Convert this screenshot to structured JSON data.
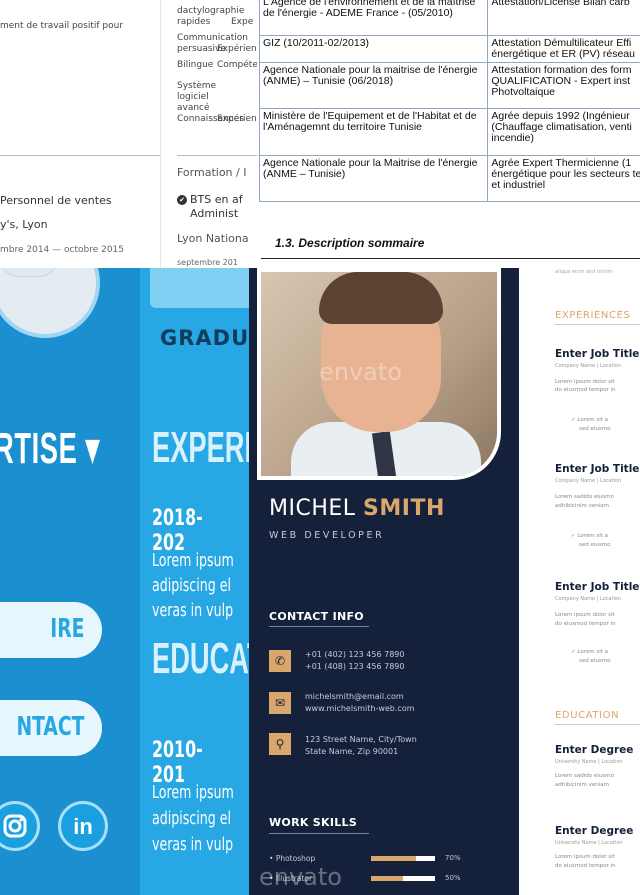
{
  "top_left": {
    "fragment": "ment de travail positif pour",
    "job_title": "Personnel de ventes",
    "employer": "y's, Lyon",
    "dates": "mbre 2014 — octobre 2015"
  },
  "top_middle": {
    "skill_rows": [
      {
        "left": "dactylographie",
        "right": ""
      },
      {
        "left": "rapides",
        "right": "Expe"
      },
      {
        "left": "Communication",
        "right": ""
      },
      {
        "left": "persuasive",
        "right": "Expérience"
      },
      {
        "left": "Bilingue",
        "right": "Compétent"
      },
      {
        "left": "Système",
        "right": ""
      },
      {
        "left": "logiciel",
        "right": ""
      },
      {
        "left": "avancé",
        "right": ""
      },
      {
        "left": "Connaissances",
        "right": "Expérience"
      }
    ],
    "formation_heading": "Formation / I",
    "education_line1": "BTS en af",
    "education_line2": "Administ",
    "location": "Lyon Nationa",
    "dates": "septembre 201"
  },
  "top_right": {
    "rows": [
      {
        "org": "L'Agence de l'environnement et de la maîtrise de l'énergie - ADEME France - (05/2010)",
        "cert": "Attestation/License  Bilan carb"
      },
      {
        "org": "GIZ (10/2011-02/2013)",
        "cert": "Attestation Démultilicateur Effi énergétique et ER (PV) réseau"
      },
      {
        "org": "Agence Nationale pour la maitrise de l'énergie                    (ANME) – Tunisie (06/2018)",
        "cert": "Attestation formation des form QUALIFICATION - Expert inst Photvoltaique"
      },
      {
        "org": "Ministère de l'Equipement et de l'Habitat et de l'Aménagemnt du territoire Tunisie",
        "cert": "Agrée depuis 1992 (Ingénieur (Chauffage climatisation, venti incendie)"
      },
      {
        "org": "Agence Nationale pour la Maitrise de l'énergie (ANME – Tunisie)",
        "cert": "Agrée Expert Thermicienne (1 énergétique pour les secteurs tertiaire et industriel"
      }
    ],
    "section_heading": "1.3. Description sommaire"
  },
  "bottom_left": {
    "graduation": "GRADUA",
    "expertise": "RTISE ▾",
    "experience": "EXPERI",
    "exp_years": "2018-202",
    "lorem_lines": [
      "Lorem ipsum",
      "adipiscing el",
      "veras in vulp"
    ],
    "pill1": "IRE",
    "pill2": "NTACT",
    "education": "EDUCAT",
    "edu_years": "2010-201",
    "lorem_lines2": [
      "Lorem ipsum",
      "adipiscing el",
      "veras in vulp"
    ],
    "social_icons": [
      "instagram-icon",
      "linkedin-icon"
    ],
    "accent_color": "#27a7e3"
  },
  "bottom_right": {
    "first_name": "MICHEL",
    "last_name": "SMITH",
    "role": "WEB DEVELOPER",
    "contact_heading": "CONTACT INFO",
    "phones": [
      "+01 (402) 123 456 7890",
      "+01 (408) 123 456 7890"
    ],
    "emails": [
      "michelsmith@email.com",
      "www.michelsmith-web.com"
    ],
    "address": [
      "123 Street Name, City/Town",
      "State Name, Zip 90001"
    ],
    "skills_heading": "WORK SKILLS",
    "skills": [
      {
        "name": "Photoshop",
        "level": 0.7,
        "label": "70%"
      },
      {
        "name": "Illustrator",
        "level": 0.5,
        "label": "50%"
      }
    ],
    "experiences_heading": "EXPERIENCES",
    "jobs": [
      {
        "title": "Enter Job Title",
        "meta": "Company Name | Location",
        "lines": [
          "Lorem ipsum dolor sit",
          "do eiusmod tempor in"
        ],
        "bullets": [
          "Lorem sit a",
          "sed eiusmo"
        ]
      },
      {
        "title": "Enter Job Title",
        "meta": "Company Name | Location",
        "lines": [
          "Lorem sadido eiusmo",
          "adhibicinim veniam"
        ],
        "bullets": [
          "Lorem sit a",
          "sed eiusmo"
        ]
      },
      {
        "title": "Enter Job Title",
        "meta": "Company Name | Location",
        "lines": [
          "Lorem ipsum dolor sit",
          "do eiusmod tempor in"
        ],
        "bullets": [
          "Lorem sit a",
          "sed eiusmo"
        ]
      }
    ],
    "education_heading": "EDUCATION",
    "degrees": [
      {
        "title": "Enter Degree",
        "meta": "University Name | Location",
        "lines": [
          "Lorem sadido eiusmo",
          "adhibicinim veniam"
        ]
      },
      {
        "title": "Enter Degree",
        "meta": "University Name | Location",
        "lines": [
          "Lorem ipsum dolor sit",
          "do eiusmod tempor in"
        ]
      }
    ],
    "top_text": "aliqua enim and minim",
    "watermark": "envato",
    "accent_color": "#d9a76b",
    "sidebar_color": "#15203a"
  }
}
